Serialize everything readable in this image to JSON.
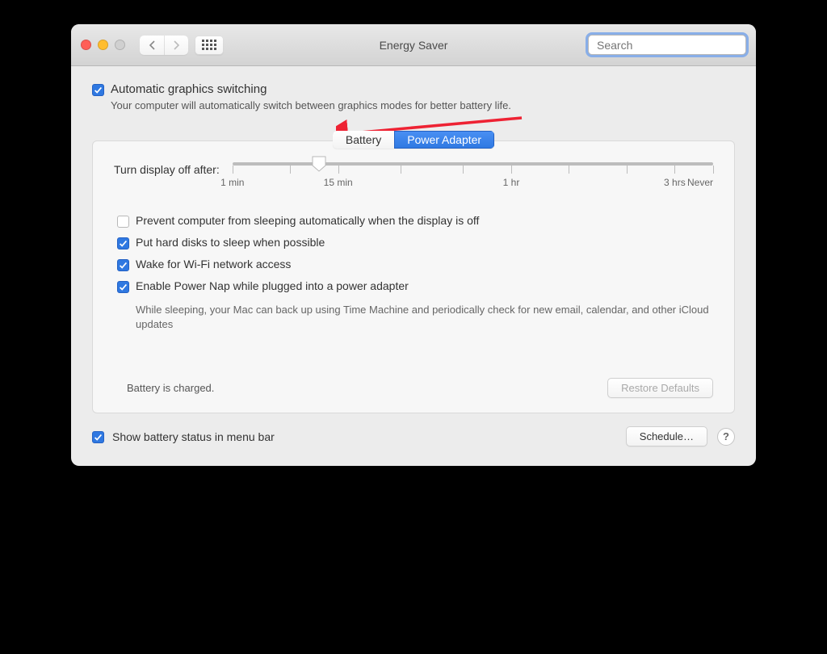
{
  "window": {
    "title": "Energy Saver"
  },
  "search": {
    "placeholder": "Search"
  },
  "auto_switching": {
    "label": "Automatic graphics switching",
    "checked": true,
    "description": "Your computer will automatically switch between graphics modes for better battery life."
  },
  "tabs": {
    "battery": "Battery",
    "power_adapter": "Power Adapter",
    "active": "power_adapter"
  },
  "slider": {
    "label": "Turn display off after:",
    "value_pct": 18,
    "ticks": [
      {
        "pct": 0,
        "label": "1 min"
      },
      {
        "pct": 12,
        "label": ""
      },
      {
        "pct": 22,
        "label": "15 min"
      },
      {
        "pct": 35,
        "label": ""
      },
      {
        "pct": 48,
        "label": ""
      },
      {
        "pct": 58,
        "label": "1 hr"
      },
      {
        "pct": 70,
        "label": ""
      },
      {
        "pct": 82,
        "label": ""
      },
      {
        "pct": 92,
        "label": "3 hrs"
      },
      {
        "pct": 100,
        "label": "Never"
      }
    ]
  },
  "options": [
    {
      "label": "Prevent computer from sleeping automatically when the display is off",
      "checked": false
    },
    {
      "label": "Put hard disks to sleep when possible",
      "checked": true
    },
    {
      "label": "Wake for Wi-Fi network access",
      "checked": true
    },
    {
      "label": "Enable Power Nap while plugged into a power adapter",
      "checked": true,
      "description": "While sleeping, your Mac can back up using Time Machine and periodically check for new email, calendar, and other iCloud updates"
    }
  ],
  "status_text": "Battery is charged.",
  "buttons": {
    "restore_defaults": "Restore Defaults",
    "schedule": "Schedule…"
  },
  "bottom_checkbox": {
    "label": "Show battery status in menu bar",
    "checked": true
  },
  "help": "?"
}
